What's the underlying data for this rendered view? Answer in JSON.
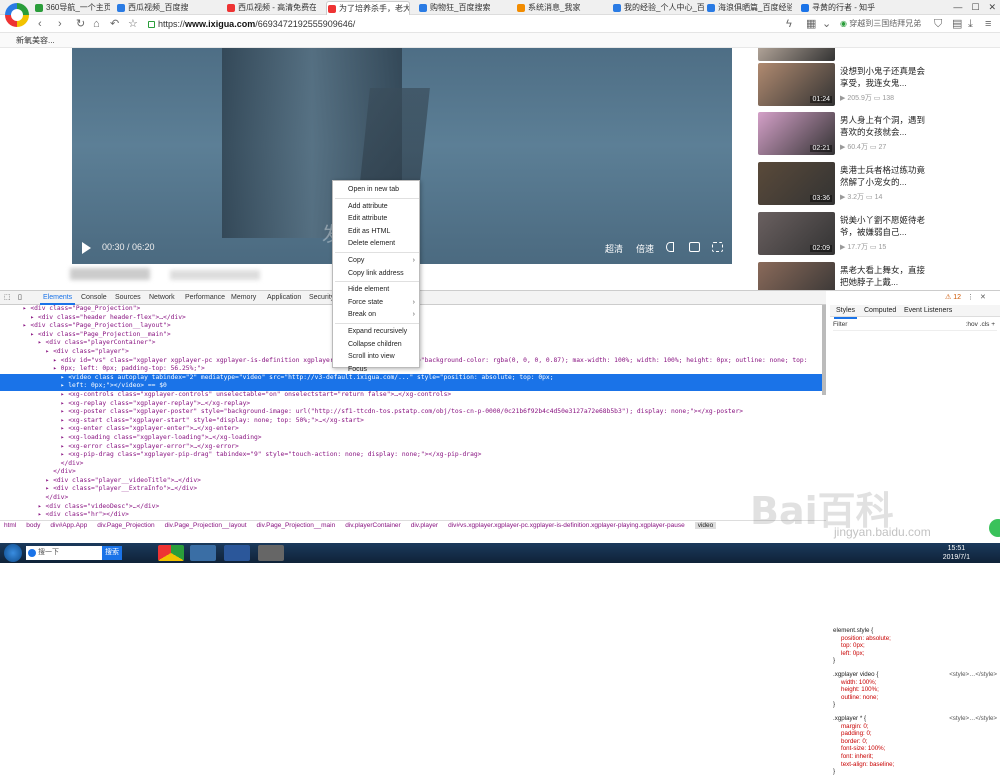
{
  "tabs": [
    {
      "title": "360导航_一个主页，整",
      "color": "#2a9d3a"
    },
    {
      "title": "西瓜视频_百度搜索",
      "color": "#2a7be4"
    },
    {
      "title": "西瓜视频 - 高清免费在",
      "color": "#e33"
    },
    {
      "title": "为了培养杀手，老大把",
      "color": "#e33"
    },
    {
      "title": "购物狂_百度搜索",
      "color": "#2a7be4"
    },
    {
      "title": "系统消息_我家",
      "color": "#f28c00"
    },
    {
      "title": "我的经验_个人中心_百",
      "color": "#2a7be4"
    },
    {
      "title": "海浪俱晒篇_百度经验",
      "color": "#2a7be4"
    },
    {
      "title": "寻黄的行者 - 知乎",
      "color": "#1a73e8"
    }
  ],
  "address": {
    "scheme": "https://",
    "host": "www.ixigua.com",
    "path": "/6693472192555909646/",
    "right_search": "穿越到三国结拜兄弟"
  },
  "bookmark": "新氧美容...",
  "video": {
    "time": "00:30 / 06:20",
    "subtitle": "发",
    "quality": "超清",
    "speed": "倍速"
  },
  "related": [
    {
      "title": "",
      "duration": "",
      "views": "",
      "comments": "",
      "color": "#d9c7b8"
    },
    {
      "title": "没想到小鬼子还真是会享受，我连女鬼...",
      "duration": "01:24",
      "views": "205.9万",
      "comments": "138",
      "color": "#b08a70"
    },
    {
      "title": "男人身上有个洞，遇到喜欢的女孩就会...",
      "duration": "02:21",
      "views": "60.4万",
      "comments": "27",
      "color": "#d4a0c8"
    },
    {
      "title": "奥港士兵者格过练功竟然解了小宠女的...",
      "duration": "03:36",
      "views": "3.2万",
      "comments": "14",
      "color": "#5a4a3a"
    },
    {
      "title": "锐美小丫劉不愿姬待老爷，被嫌弱自己...",
      "duration": "02:09",
      "views": "17.7万",
      "comments": "15",
      "color": "#6a6060"
    },
    {
      "title": "黑老大看上舞女，直接把她脖子上戴...",
      "duration": "",
      "views": "",
      "comments": "",
      "color": "#8a6a5a"
    }
  ],
  "devtools": {
    "tabs": [
      "Elements",
      "Console",
      "Sources",
      "Network",
      "Performance",
      "Memory",
      "Application",
      "Security"
    ],
    "warnings": "12",
    "dom_lines": [
      {
        "indent": 3,
        "text": "<div class=\"Page_Projection\">",
        "sel": false
      },
      {
        "indent": 4,
        "text": "<div class=\"header header-flex\">…</div>",
        "sel": false
      },
      {
        "indent": 3,
        "text": "<div class=\"Page_Projection__layout\">",
        "sel": false
      },
      {
        "indent": 4,
        "text": "<div class=\"Page_Projection__main\">",
        "sel": false
      },
      {
        "indent": 5,
        "text": "<div class=\"playerContainer\">",
        "sel": false
      },
      {
        "indent": 6,
        "text": "<div class=\"player\">",
        "sel": false
      },
      {
        "indent": 7,
        "text": "<div id=\"vs\" class=\"xgplayer xgplayer-pc xgplayer-is-definition xgplayer-playing\" ...\"0\" style=\"background-color: rgba(0, 0, 0, 0.87); max-width: 100%; width: 100%; height: 0px; outline: none; top:",
        "sel": false
      },
      {
        "indent": 7,
        "text": "0px; left: 0px; padding-top: 56.25%;\">",
        "sel": false
      },
      {
        "indent": 8,
        "text": "<video class autoplay tabindex=\"2\" mediatype=\"video\" src=\"http://v3-default.ixigua.com/...\" style=\"position: absolute; top: 0px;",
        "sel": true
      },
      {
        "indent": 8,
        "text": "left: 0px;\"></video> == $0",
        "sel": true
      },
      {
        "indent": 8,
        "text": "<xg-controls class=\"xgplayer-controls\" unselectable=\"on\" onselectstart=\"return false\">…</xg-controls>",
        "sel": false
      },
      {
        "indent": 8,
        "text": "<xg-replay class=\"xgplayer-replay\">…</xg-replay>",
        "sel": false
      },
      {
        "indent": 8,
        "text": "<xg-poster class=\"xgplayer-poster\" style=\"background-image: url(\"http://sf1-ttcdn-tos.pstatp.com/obj/tos-cn-p-0000/0c21b6f92b4c4d50e3127a72e68b5b3\"); display: none;\"></xg-poster>",
        "sel": false
      },
      {
        "indent": 8,
        "text": "<xg-start class=\"xgplayer-start\" style=\"display: none; top: 50%;\">…</xg-start>",
        "sel": false
      },
      {
        "indent": 8,
        "text": "<xg-enter class=\"xgplayer-enter\">…</xg-enter>",
        "sel": false
      },
      {
        "indent": 8,
        "text": "<xg-loading class=\"xgplayer-loading\">…</xg-loading>",
        "sel": false
      },
      {
        "indent": 8,
        "text": "<xg-error class=\"xgplayer-error\">…</xg-error>",
        "sel": false
      },
      {
        "indent": 8,
        "text": "<xg-pip-drag class=\"xgplayer-pip-drag\" tabindex=\"9\" style=\"touch-action: none; display: none;\"></xg-pip-drag>",
        "sel": false
      },
      {
        "indent": 7,
        "text": "</div>",
        "sel": false
      },
      {
        "indent": 6,
        "text": "</div>",
        "sel": false
      },
      {
        "indent": 6,
        "text": "<div class=\"player__videoTitle\">…</div>",
        "sel": false
      },
      {
        "indent": 6,
        "text": "<div class=\"player__ExtraInfo\">…</div>",
        "sel": false
      },
      {
        "indent": 5,
        "text": "</div>",
        "sel": false
      },
      {
        "indent": 5,
        "text": "<div class=\"videoDesc\">…</div>",
        "sel": false
      },
      {
        "indent": 5,
        "text": "<div class=\"hr\"></div>",
        "sel": false
      },
      {
        "indent": 5,
        "text": "<div class=\"Page_Projection__comment\">…</div>",
        "sel": false
      }
    ],
    "breadcrumbs": [
      "html",
      "body",
      "div#App.App",
      "div.Page_Projection",
      "div.Page_Projection__layout",
      "div.Page_Projection__main",
      "div.playerContainer",
      "div.player",
      "div#vs.xgplayer.xgplayer-pc.xgplayer-is-definition.xgplayer-playing.xgplayer-pause",
      "video"
    ],
    "styles_tabs": [
      "Styles",
      "Computed",
      "Event Listeners"
    ],
    "filter_placeholder": "Filter",
    "filter_right": ":hov .cls +",
    "rules": [
      {
        "selector": "element.style {",
        "source": "",
        "props": [
          "position: absolute;",
          "top: 0px;",
          "left: 0px;"
        ]
      },
      {
        "selector": ".xgplayer video {",
        "source": "<style>…</style>",
        "props": [
          "width: 100%;",
          "height: 100%;",
          "outline: none;"
        ]
      },
      {
        "selector": ".xgplayer * {",
        "source": "<style>…</style>",
        "props": [
          "margin: 0;",
          "padding: 0;",
          "border: 0;",
          "font-size: 100%;",
          "font: inherit;",
          "text-align: baseline;"
        ]
      }
    ]
  },
  "context_menu": [
    {
      "label": "Open in new tab",
      "arrow": false
    },
    {
      "sep": true
    },
    {
      "label": "Add attribute",
      "arrow": false
    },
    {
      "label": "Edit attribute",
      "arrow": false
    },
    {
      "label": "Edit as HTML",
      "arrow": false
    },
    {
      "label": "Delete element",
      "arrow": false
    },
    {
      "sep": true
    },
    {
      "label": "Copy",
      "arrow": true
    },
    {
      "label": "Copy link address",
      "arrow": false
    },
    {
      "sep": true
    },
    {
      "label": "Hide element",
      "arrow": false
    },
    {
      "label": "Force state",
      "arrow": true
    },
    {
      "label": "Break on",
      "arrow": true
    },
    {
      "sep": true
    },
    {
      "label": "Expand recursively",
      "arrow": false
    },
    {
      "label": "Collapse children",
      "arrow": false
    },
    {
      "label": "Scroll into view",
      "arrow": false
    },
    {
      "label": "Focus",
      "arrow": false
    }
  ],
  "taskbar": {
    "search_placeholder": "搜一下",
    "search_btn": "搜索",
    "time": "15:51",
    "date": "2019/7/1"
  },
  "watermark": "Bai百科",
  "watermark_sub": "jingyan.baidu.com"
}
